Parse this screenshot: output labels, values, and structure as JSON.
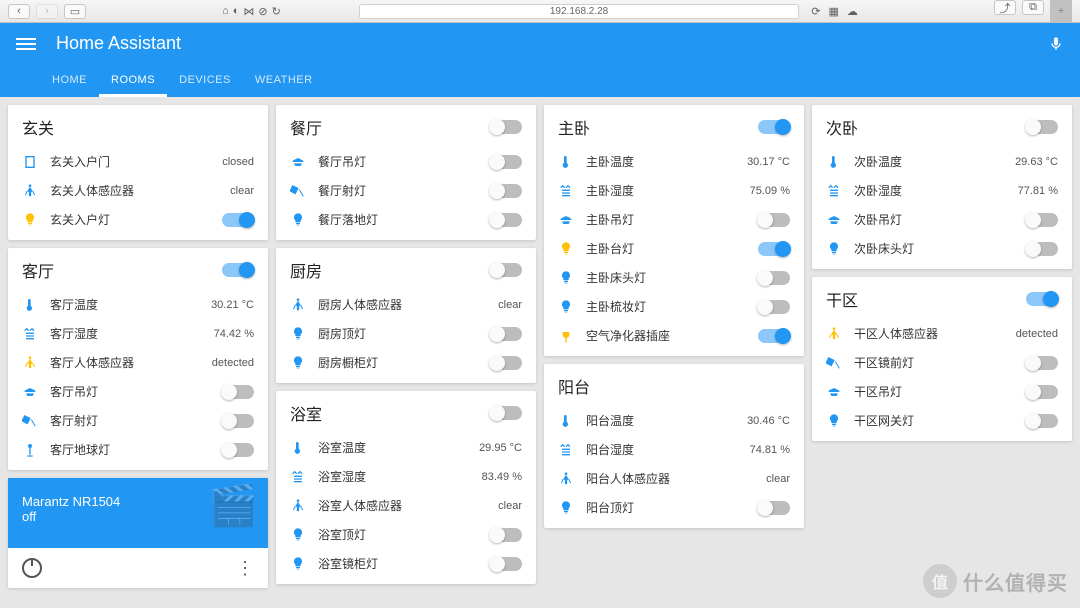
{
  "browser": {
    "url": "192.168.2.28"
  },
  "app": {
    "title": "Home Assistant"
  },
  "nav": {
    "tabs": [
      "HOME",
      "ROOMS",
      "DEVICES",
      "WEATHER"
    ],
    "active": 1
  },
  "cards": {
    "xuanguan": {
      "title": "玄关",
      "items": [
        {
          "icon": "door",
          "label": "玄关入户门",
          "value": "closed"
        },
        {
          "icon": "motion",
          "label": "玄关人体感应器",
          "value": "clear"
        },
        {
          "icon": "bulb-on",
          "label": "玄关入户灯",
          "toggle": true,
          "on": true
        }
      ]
    },
    "keting": {
      "title": "客厅",
      "headToggle": true,
      "items": [
        {
          "icon": "thermo",
          "label": "客厅温度",
          "value": "30.21 °C"
        },
        {
          "icon": "humid",
          "label": "客厅湿度",
          "value": "74.42 %"
        },
        {
          "icon": "motion-on",
          "label": "客厅人体感应器",
          "value": "detected"
        },
        {
          "icon": "ceiling",
          "label": "客厅吊灯",
          "toggle": true,
          "on": false
        },
        {
          "icon": "spot",
          "label": "客厅射灯",
          "toggle": true,
          "on": false
        },
        {
          "icon": "floor",
          "label": "客厅地球灯",
          "toggle": true,
          "on": false
        }
      ]
    },
    "canting": {
      "title": "餐厅",
      "headToggle": false,
      "items": [
        {
          "icon": "ceiling",
          "label": "餐厅吊灯",
          "toggle": true,
          "on": false
        },
        {
          "icon": "spot",
          "label": "餐厅射灯",
          "toggle": true,
          "on": false
        },
        {
          "icon": "bulb",
          "label": "餐厅落地灯",
          "toggle": true,
          "on": false
        }
      ]
    },
    "chufang": {
      "title": "厨房",
      "headToggle": false,
      "items": [
        {
          "icon": "motion",
          "label": "厨房人体感应器",
          "value": "clear"
        },
        {
          "icon": "bulb",
          "label": "厨房顶灯",
          "toggle": true,
          "on": false
        },
        {
          "icon": "bulb",
          "label": "厨房橱柜灯",
          "toggle": true,
          "on": false
        }
      ]
    },
    "yushi": {
      "title": "浴室",
      "headToggle": false,
      "items": [
        {
          "icon": "thermo",
          "label": "浴室温度",
          "value": "29.95 °C"
        },
        {
          "icon": "humid",
          "label": "浴室湿度",
          "value": "83.49 %"
        },
        {
          "icon": "motion",
          "label": "浴室人体感应器",
          "value": "clear"
        },
        {
          "icon": "bulb",
          "label": "浴室顶灯",
          "toggle": true,
          "on": false
        },
        {
          "icon": "bulb",
          "label": "浴室镜柜灯",
          "toggle": true,
          "on": false
        }
      ]
    },
    "zhuwo": {
      "title": "主卧",
      "headToggle": true,
      "items": [
        {
          "icon": "thermo",
          "label": "主卧温度",
          "value": "30.17 °C"
        },
        {
          "icon": "humid",
          "label": "主卧湿度",
          "value": "75.09 %"
        },
        {
          "icon": "ceiling",
          "label": "主卧吊灯",
          "toggle": true,
          "on": false
        },
        {
          "icon": "bulb-on",
          "label": "主卧台灯",
          "toggle": true,
          "on": true
        },
        {
          "icon": "bulb",
          "label": "主卧床头灯",
          "toggle": true,
          "on": false
        },
        {
          "icon": "bulb",
          "label": "主卧梳妆灯",
          "toggle": true,
          "on": false
        },
        {
          "icon": "plug",
          "label": "空气净化器插座",
          "toggle": true,
          "on": true
        }
      ]
    },
    "yangtai": {
      "title": "阳台",
      "items": [
        {
          "icon": "thermo",
          "label": "阳台温度",
          "value": "30.46 °C"
        },
        {
          "icon": "humid",
          "label": "阳台湿度",
          "value": "74.81 %"
        },
        {
          "icon": "motion",
          "label": "阳台人体感应器",
          "value": "clear"
        },
        {
          "icon": "bulb",
          "label": "阳台顶灯",
          "toggle": true,
          "on": false
        }
      ]
    },
    "ciwo": {
      "title": "次卧",
      "headToggle": false,
      "items": [
        {
          "icon": "thermo",
          "label": "次卧温度",
          "value": "29.63 °C"
        },
        {
          "icon": "humid",
          "label": "次卧湿度",
          "value": "77.81 %"
        },
        {
          "icon": "ceiling",
          "label": "次卧吊灯",
          "toggle": true,
          "on": false
        },
        {
          "icon": "bulb",
          "label": "次卧床头灯",
          "toggle": true,
          "on": false
        }
      ]
    },
    "ganqu": {
      "title": "干区",
      "headToggle": true,
      "items": [
        {
          "icon": "motion-on",
          "label": "干区人体感应器",
          "value": "detected"
        },
        {
          "icon": "spot",
          "label": "干区镜前灯",
          "toggle": true,
          "on": false
        },
        {
          "icon": "ceiling",
          "label": "干区吊灯",
          "toggle": true,
          "on": false
        },
        {
          "icon": "bulb",
          "label": "干区网关灯",
          "toggle": true,
          "on": false
        }
      ]
    }
  },
  "media": {
    "title": "Marantz NR1504",
    "state": "off"
  },
  "watermark": "什么值得买"
}
